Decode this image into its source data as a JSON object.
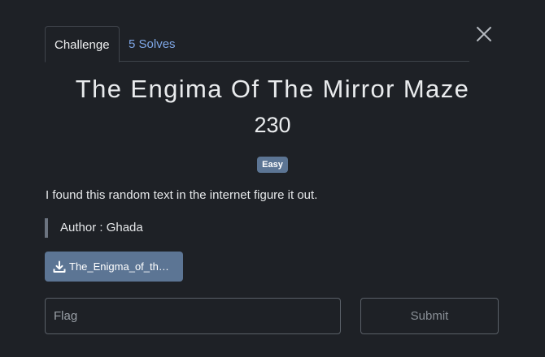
{
  "tabs": [
    {
      "label": "Challenge",
      "active": true
    },
    {
      "label": "5 Solves",
      "active": false
    }
  ],
  "challenge": {
    "title": "The Engima Of The Mirror Maze",
    "points": "230",
    "difficulty": "Easy",
    "description": "I found this random text in the internet figure it out.",
    "author": "Author : Ghada",
    "file_label": "The_Enigma_of_the_Mirror_Maze.txt"
  },
  "form": {
    "flag_placeholder": "Flag",
    "submit_label": "Submit"
  },
  "icons": {
    "close": "close-icon",
    "download": "download-icon"
  },
  "colors": {
    "background": "#1e2126",
    "accent": "#5c7594",
    "link": "#7ea6e6"
  }
}
